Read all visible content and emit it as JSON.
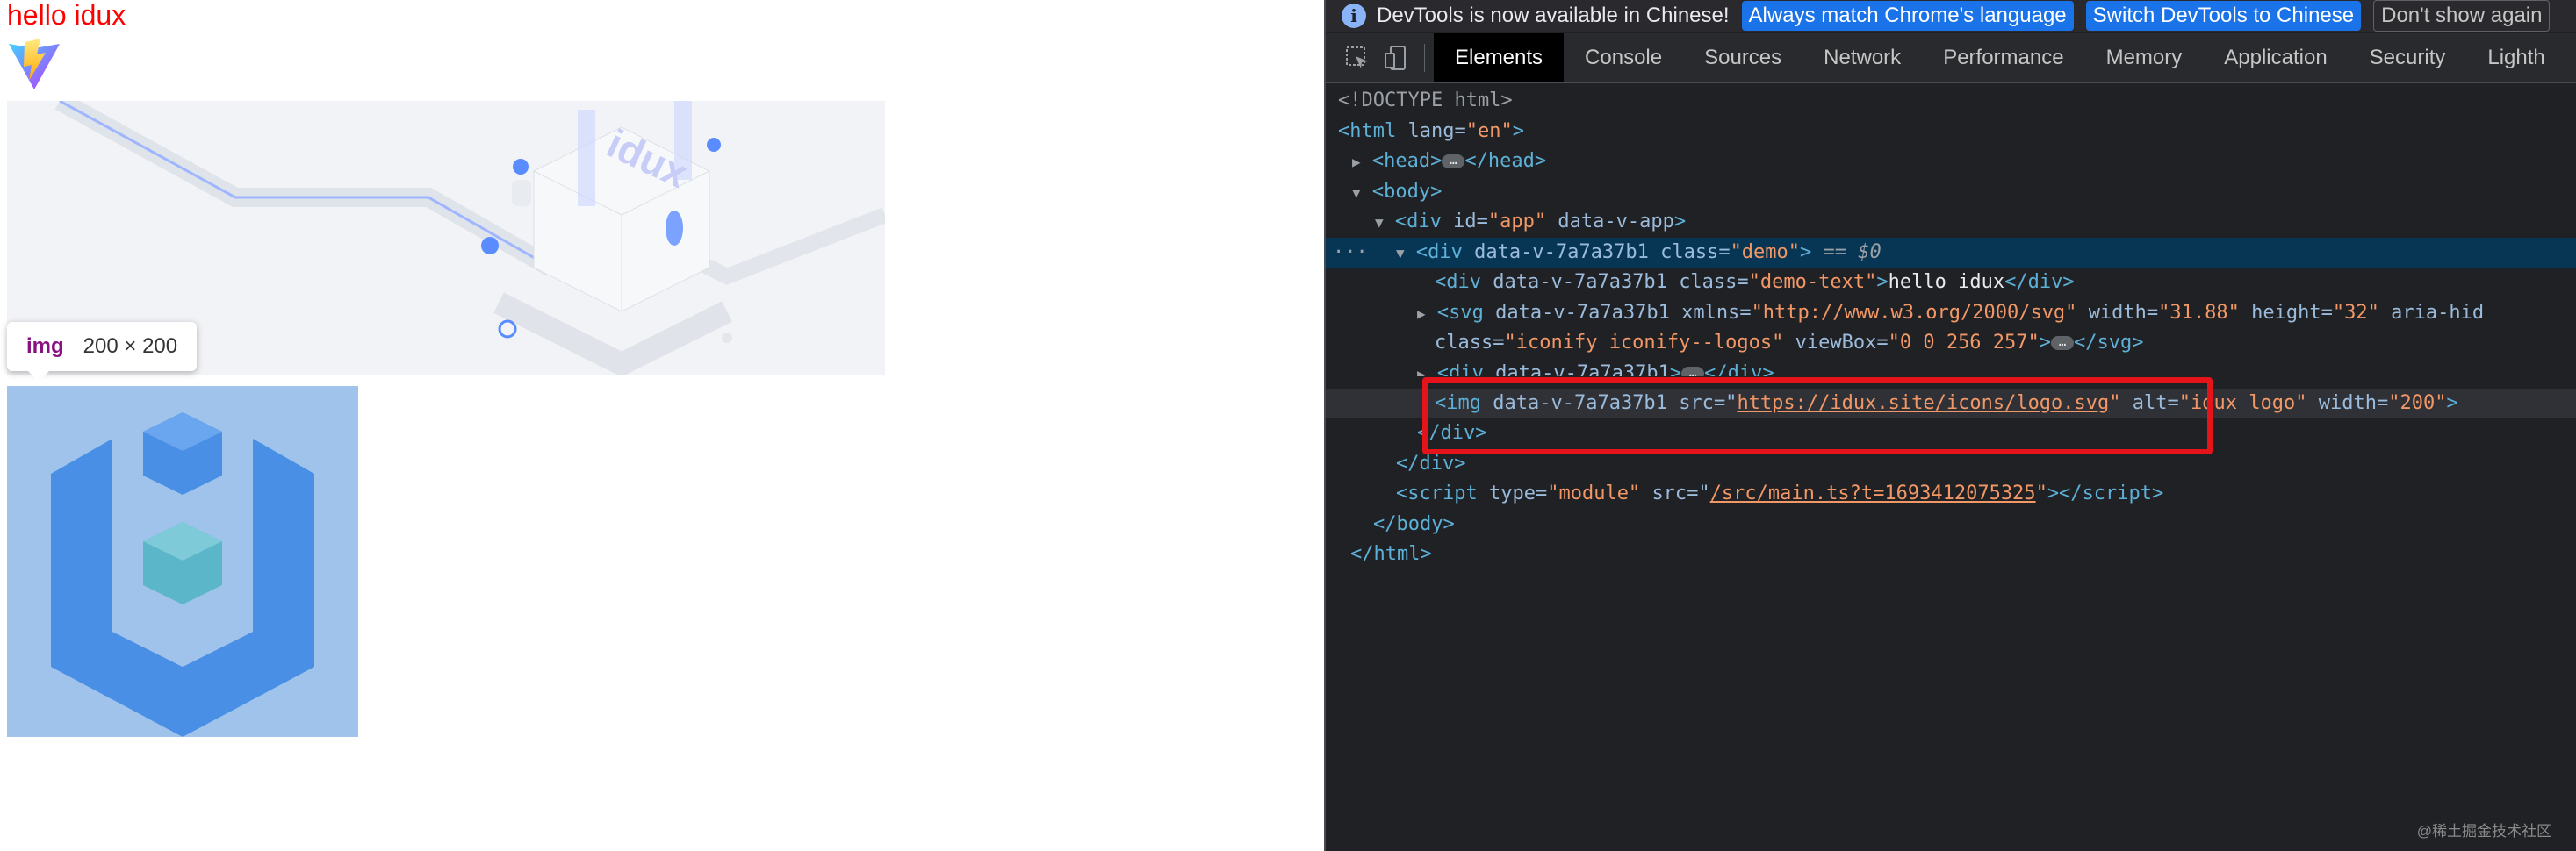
{
  "page": {
    "hello_text": "hello idux",
    "tooltip": {
      "tag": "img",
      "dims": "200 × 200"
    }
  },
  "devtools": {
    "infobar": {
      "message": "DevTools is now available in Chinese!",
      "btn_match": "Always match Chrome's language",
      "btn_switch": "Switch DevTools to Chinese",
      "btn_dismiss": "Don't show again"
    },
    "tabs": [
      "Elements",
      "Console",
      "Sources",
      "Network",
      "Performance",
      "Memory",
      "Application",
      "Security",
      "Lighth"
    ],
    "active_tab": "Elements",
    "dom": {
      "doctype": "<!DOCTYPE html>",
      "html_open": "html",
      "lang_attr": "lang",
      "lang_val": "\"en\"",
      "head": "head",
      "body": "body",
      "div": "div",
      "app_id_attr": "id",
      "app_id_val": "\"app\"",
      "data_v_app": "data-v-app",
      "scope_attr": "data-v-7a7a37b1",
      "class_attr": "class",
      "demo_class": "\"demo\"",
      "sel_marker": "== $0",
      "demo_text_class": "\"demo-text\"",
      "demo_text_content": "hello idux",
      "svg": "svg",
      "xmlns_attr": "xmlns",
      "xmlns_val": "\"http://www.w3.org/2000/svg\"",
      "width_attr": "width",
      "svg_width": "\"31.88\"",
      "height_attr": "height",
      "svg_height": "\"32\"",
      "aria_attr": "aria-hid",
      "svg_class": "\"iconify iconify--logos\"",
      "viewbox_attr": "viewBox",
      "viewbox_val": "\"0 0 256 257\"",
      "img": "img",
      "src_attr": "src",
      "img_src": "https://idux.site/icons/logo.svg",
      "alt_attr": "alt",
      "img_alt": "\"idux logo\"",
      "img_width": "\"200\"",
      "script": "script",
      "type_attr": "type",
      "script_type": "\"module\"",
      "script_src": "/src/main.ts?t=1693412075325"
    }
  },
  "watermark": "@稀土掘金技术社区",
  "colors": {
    "hello": "#ff0000",
    "selection": "#073655",
    "highlight_box": "#e5141b",
    "tag": "#5db0d7",
    "attr": "#9bbbdc",
    "value": "#f29766"
  }
}
